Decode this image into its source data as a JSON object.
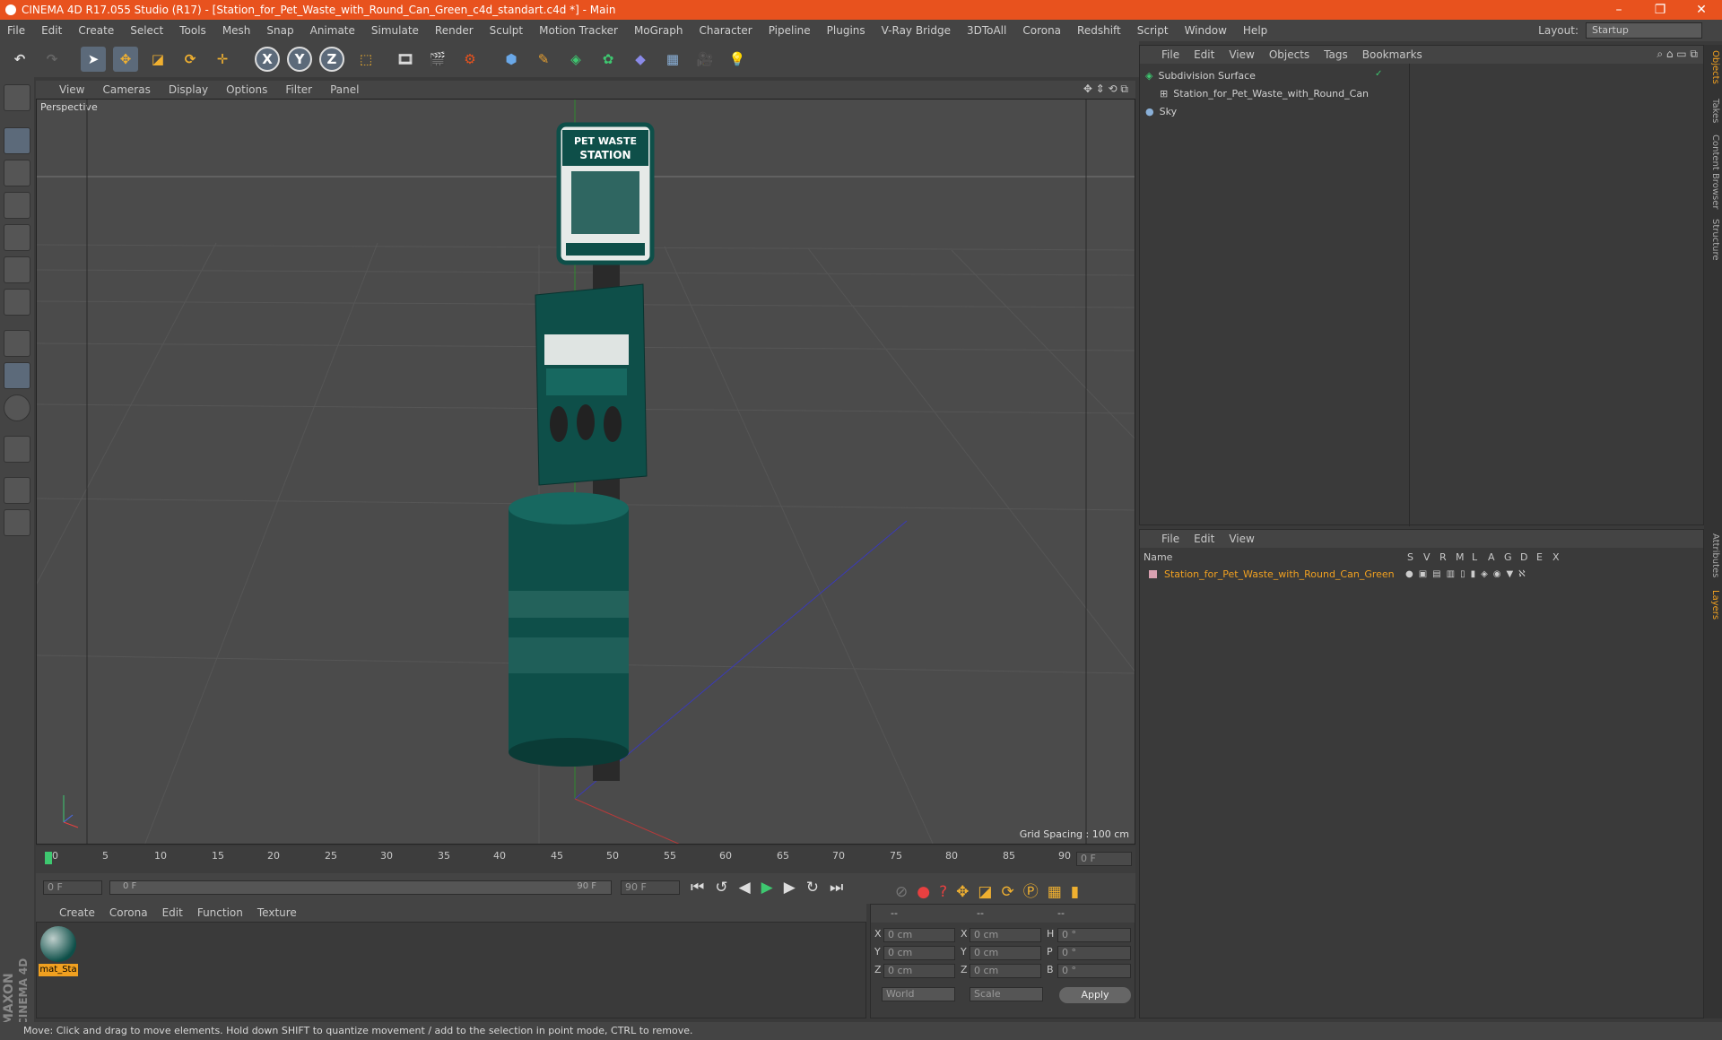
{
  "window": {
    "title": "CINEMA 4D R17.055 Studio (R17) - [Station_for_Pet_Waste_with_Round_Can_Green_c4d_standart.c4d *] - Main",
    "minimize": "–",
    "restore": "❐",
    "close": "✕"
  },
  "menubar": {
    "items": [
      "File",
      "Edit",
      "Create",
      "Select",
      "Tools",
      "Mesh",
      "Snap",
      "Animate",
      "Simulate",
      "Render",
      "Sculpt",
      "Motion Tracker",
      "MoGraph",
      "Character",
      "Pipeline",
      "Plugins",
      "V-Ray Bridge",
      "3DToAll",
      "Corona",
      "Redshift",
      "Script",
      "Window",
      "Help"
    ],
    "layout_label": "Layout:",
    "layout_value": "Startup"
  },
  "toolbar": {
    "x_label": "X",
    "y_label": "Y",
    "z_label": "Z"
  },
  "viewport": {
    "menu": [
      "View",
      "Cameras",
      "Display",
      "Options",
      "Filter",
      "Panel"
    ],
    "label": "Perspective",
    "grid_spacing": "Grid Spacing : 100 cm",
    "sign_top": "PET WASTE",
    "sign_mid": "STATION"
  },
  "timeline": {
    "ticks": [
      "0",
      "5",
      "10",
      "15",
      "20",
      "25",
      "30",
      "35",
      "40",
      "45",
      "50",
      "55",
      "60",
      "65",
      "70",
      "75",
      "80",
      "85",
      "90"
    ],
    "current_frame": "0 F",
    "start_field": "0 F",
    "range_start": "0 F",
    "range_end": "90 F",
    "end_field": "90 F"
  },
  "material_manager": {
    "menu": [
      "Create",
      "Corona",
      "Edit",
      "Function",
      "Texture"
    ],
    "material_name": "mat_Sta"
  },
  "coords": {
    "header": [
      "--",
      "--",
      "--"
    ],
    "rows": [
      {
        "a": "X",
        "av": "0 cm",
        "b": "X",
        "bv": "0 cm",
        "c": "H",
        "cv": "0 °"
      },
      {
        "a": "Y",
        "av": "0 cm",
        "b": "Y",
        "bv": "0 cm",
        "c": "P",
        "cv": "0 °"
      },
      {
        "a": "Z",
        "av": "0 cm",
        "b": "Z",
        "bv": "0 cm",
        "c": "B",
        "cv": "0 °"
      }
    ],
    "world": "World",
    "scale": "Scale",
    "apply": "Apply"
  },
  "object_manager": {
    "menu": [
      "File",
      "Edit",
      "View",
      "Objects",
      "Tags",
      "Bookmarks"
    ],
    "items": [
      {
        "name": "Subdivision Surface",
        "indent": 0
      },
      {
        "name": "Station_for_Pet_Waste_with_Round_Can",
        "indent": 1
      },
      {
        "name": "Sky",
        "indent": 0
      }
    ]
  },
  "layer_manager": {
    "menu": [
      "File",
      "Edit",
      "View"
    ],
    "name_header": "Name",
    "cols": [
      "S",
      "V",
      "R",
      "M",
      "L",
      "A",
      "G",
      "D",
      "E",
      "X"
    ],
    "layer_name": "Station_for_Pet_Waste_with_Round_Can_Green"
  },
  "right_tabs": [
    "Objects",
    "Takes",
    "Content Browser",
    "Structure",
    "Attributes",
    "Layers"
  ],
  "brand": {
    "line1": "MAXON",
    "line2": "CINEMA 4D"
  },
  "status": "Move: Click and drag to move elements. Hold down SHIFT to quantize movement / add to the selection in point mode, CTRL to remove.",
  "colors": {
    "accent": "#e8521e",
    "green": "#0e4f49",
    "layer": "#f0a020"
  }
}
